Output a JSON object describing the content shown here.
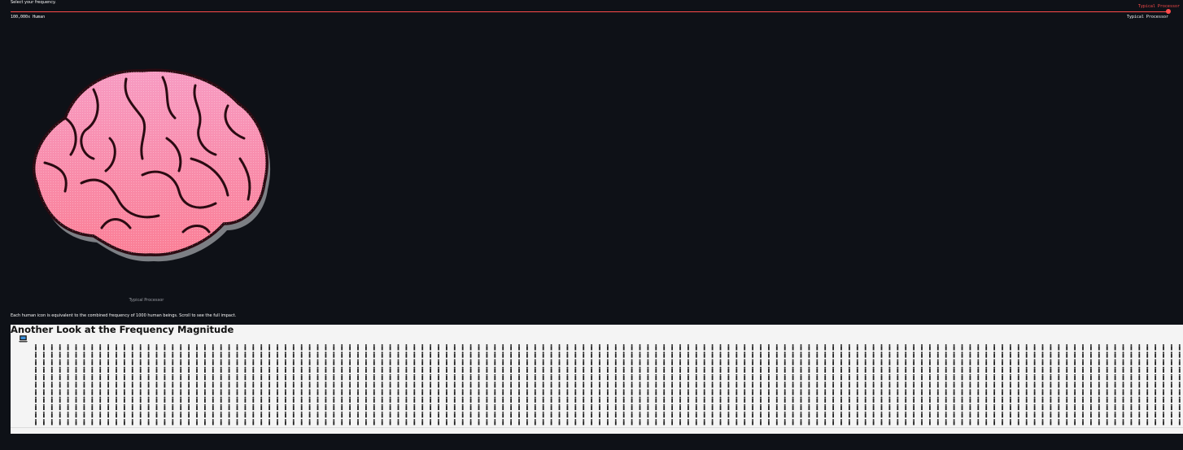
{
  "slider": {
    "label": "Select your frequency.",
    "value_label": "Typical Processor",
    "min_label": "100,000x Human",
    "max_label": "Typical Processor",
    "position": 1.0
  },
  "image": {
    "caption": "Typical Processor"
  },
  "note": "Each human icon is equivalent to the combined frequency of 1000 human beings. Scroll to see the full impact.",
  "panel": {
    "title": "Another Look at the Frequency Magnitude",
    "icons": {
      "processor": "laptop-icon",
      "human": "human-icon",
      "rows": 11,
      "columns": 143
    }
  },
  "colors": {
    "background": "#0e1117",
    "accent": "#ff4b4b",
    "panel": "#f4f4f4",
    "brain": "#f58fb4"
  }
}
